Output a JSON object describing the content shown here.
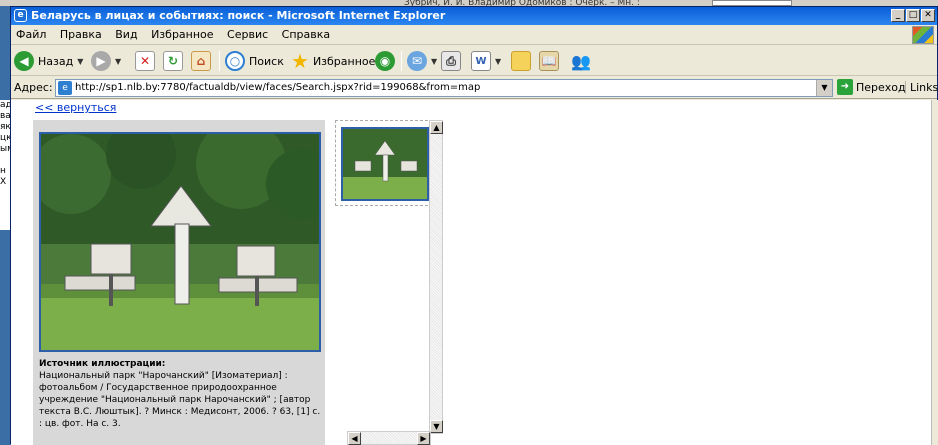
{
  "background_window": {
    "text": "Зубрич, И. И. Владимир Одомиков : Очерк. – Мн. :",
    "left_strip_lines": [
      "ад",
      "ва",
      "як",
      "цк",
      "ым",
      "",
      "н",
      "X"
    ]
  },
  "window": {
    "title": "Беларусь в лицах и событиях: поиск - Microsoft Internet Explorer",
    "controls": [
      "_",
      "□",
      "✕"
    ]
  },
  "menu": {
    "items": [
      "Файл",
      "Правка",
      "Вид",
      "Избранное",
      "Сервис",
      "Справка"
    ]
  },
  "toolbar": {
    "back_label": "Назад",
    "search_label": "Поиск",
    "favorites_label": "Избранное"
  },
  "address": {
    "label": "Адрес:",
    "url": "http://sp1.nlb.by:7780/factualdb/view/faces/Search.jspx?rid=199068&from=map",
    "go_label": "Переход",
    "links_label": "Links"
  },
  "content": {
    "back_link": "<< вернуться",
    "caption_title": "Источник иллюстрации:",
    "caption_text": "Национальный парк \"Нарочанский\" [Изоматериал] : фотоальбом / Государственное природоохранное учреждение \"Национальный парк Нарочанский\" ; [автор текста В.С. Люштык]. ? Минск : Медисонт, 2006. ? 63, [1] с. : цв. фот. На с. 3."
  },
  "colors": {
    "titlebar": "#0a5fd8",
    "photo_border": "#2c5fa8",
    "link": "#0033cc"
  }
}
